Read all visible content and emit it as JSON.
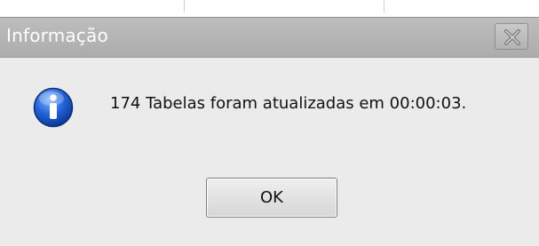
{
  "dialog": {
    "title": "Informação",
    "message": "174 Tabelas foram atualizadas em 00:00:03.",
    "ok_label": "OK",
    "icon": "info-icon",
    "close_icon": "close-icon"
  },
  "colors": {
    "titlebar": "#b5b5b5",
    "title_text": "#ffffff",
    "body": "#ebebeb",
    "icon_blue": "#1f5fc8"
  }
}
